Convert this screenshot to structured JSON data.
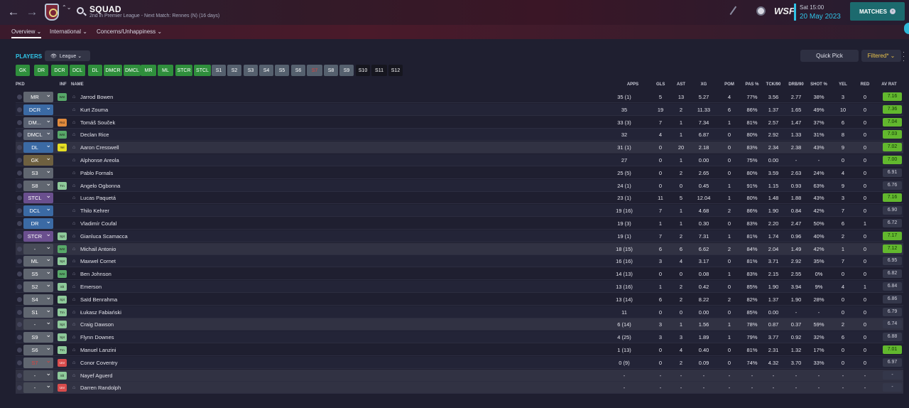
{
  "header": {
    "title": "SQUAD",
    "subtitle": "2nd in Premier League - Next Match: Rennes (N) (16 days)",
    "logo_text": "WSF",
    "date_line1": "Sat 15:00",
    "date_line2": "20 May 2023",
    "matches_label": "MATCHES",
    "back_icon": "←",
    "forward_icon": "→",
    "updown_icon": "⌃⌄"
  },
  "tabs": [
    {
      "label": "Overview ⌄"
    },
    {
      "label": "International ⌄"
    },
    {
      "label": "Concerns/Unhappiness ⌄"
    }
  ],
  "toolbar": {
    "players_label": "PLAYERS",
    "league_label": "League ⌄",
    "quick_pick_label": "Quick Pick",
    "filtered_label": "Filtered* ⌄"
  },
  "position_chips": [
    "GK",
    "DR",
    "DCR",
    "DCL",
    "DL",
    "DMCR",
    "DMCL",
    "MR",
    "ML",
    "STCR",
    "STCL",
    "S1",
    "S2",
    "S3",
    "S4",
    "S5",
    "S6",
    "S7",
    "S8",
    "S9",
    "S10",
    "S11",
    "S12"
  ],
  "columns": [
    "PKD",
    "INF",
    "NAME",
    "APPS",
    "GLS",
    "AST",
    "XG",
    "POM",
    "PAS %",
    "TCK/90",
    "DRB/90",
    "SHOT %",
    "YEL",
    "RED",
    "AV RAT"
  ],
  "players": [
    {
      "pos": "MR",
      "inf": "Wnt",
      "name": "Jarrod Bowen",
      "apps": "35 (1)",
      "gls": "5",
      "ast": "13",
      "xg": "5.27",
      "pom": "4",
      "pas": "77%",
      "tck": "3.56",
      "drb": "2.77",
      "shot": "38%",
      "yel": "3",
      "red": "0",
      "rat": "7.16"
    },
    {
      "pos": "DCR",
      "inf": "",
      "name": "Kurt Zouma",
      "apps": "35",
      "gls": "19",
      "ast": "2",
      "xg": "11.33",
      "pom": "6",
      "pas": "86%",
      "tck": "1.37",
      "drb": "1.65",
      "shot": "49%",
      "yel": "10",
      "red": "0",
      "rat": "7.36"
    },
    {
      "pos": "DM...",
      "inf": "Rst",
      "name": "Tomáš Souček",
      "apps": "33 (3)",
      "gls": "7",
      "ast": "1",
      "xg": "7.34",
      "pom": "1",
      "pas": "81%",
      "tck": "2.57",
      "drb": "1.47",
      "shot": "37%",
      "yel": "6",
      "red": "0",
      "rat": "7.04"
    },
    {
      "pos": "DMCL",
      "inf": "Wnt",
      "name": "Declan Rice",
      "apps": "32",
      "gls": "4",
      "ast": "1",
      "xg": "6.87",
      "pom": "0",
      "pas": "80%",
      "tck": "2.92",
      "drb": "1.33",
      "shot": "31%",
      "yel": "8",
      "red": "0",
      "rat": "7.03"
    },
    {
      "pos": "DL",
      "inf": "Yel",
      "name": "Aaron Cresswell",
      "apps": "31 (1)",
      "gls": "0",
      "ast": "20",
      "xg": "2.18",
      "pom": "0",
      "pas": "83%",
      "tck": "2.34",
      "drb": "2.38",
      "shot": "43%",
      "yel": "9",
      "red": "0",
      "rat": "7.02"
    },
    {
      "pos": "GK",
      "inf": "",
      "name": "Alphonse Areola",
      "apps": "27",
      "gls": "0",
      "ast": "1",
      "xg": "0.00",
      "pom": "0",
      "pas": "75%",
      "tck": "0.00",
      "drb": "-",
      "shot": "-",
      "yel": "0",
      "red": "0",
      "rat": "7.00"
    },
    {
      "pos": "S3",
      "inf": "",
      "name": "Pablo Fornals",
      "apps": "25 (5)",
      "gls": "0",
      "ast": "2",
      "xg": "2.65",
      "pom": "0",
      "pas": "80%",
      "tck": "3.59",
      "drb": "2.63",
      "shot": "24%",
      "yel": "4",
      "red": "0",
      "rat": "6.91"
    },
    {
      "pos": "S8",
      "inf": "Tm",
      "name": "Angelo Ogbonna",
      "apps": "24 (1)",
      "gls": "0",
      "ast": "0",
      "xg": "0.45",
      "pom": "1",
      "pas": "91%",
      "tck": "1.15",
      "drb": "0.93",
      "shot": "63%",
      "yel": "9",
      "red": "0",
      "rat": "6.76"
    },
    {
      "pos": "STCL",
      "inf": "",
      "name": "Lucas Paquetá",
      "apps": "23 (1)",
      "gls": "11",
      "ast": "5",
      "xg": "12.04",
      "pom": "1",
      "pas": "80%",
      "tck": "1.48",
      "drb": "1.88",
      "shot": "43%",
      "yel": "3",
      "red": "0",
      "rat": "7.16"
    },
    {
      "pos": "DCL",
      "inf": "",
      "name": "Thilo Kehrer",
      "apps": "19 (16)",
      "gls": "7",
      "ast": "1",
      "xg": "4.68",
      "pom": "2",
      "pas": "86%",
      "tck": "1.90",
      "drb": "0.84",
      "shot": "42%",
      "yel": "7",
      "red": "0",
      "rat": "6.90"
    },
    {
      "pos": "DR",
      "inf": "",
      "name": "Vladimír Coufal",
      "apps": "19 (3)",
      "gls": "1",
      "ast": "1",
      "xg": "0.30",
      "pom": "0",
      "pas": "83%",
      "tck": "2.20",
      "drb": "2.47",
      "shot": "50%",
      "yel": "6",
      "red": "1",
      "rat": "6.72"
    },
    {
      "pos": "STCR",
      "inf": "Spt",
      "name": "Gianluca Scamacca",
      "apps": "19 (1)",
      "gls": "7",
      "ast": "2",
      "xg": "7.31",
      "pom": "1",
      "pas": "81%",
      "tck": "1.74",
      "drb": "0.96",
      "shot": "40%",
      "yel": "2",
      "red": "0",
      "rat": "7.17"
    },
    {
      "pos": "-",
      "inf": "Wnt",
      "name": "Michail Antonio",
      "apps": "18 (15)",
      "gls": "6",
      "ast": "6",
      "xg": "6.62",
      "pom": "2",
      "pas": "84%",
      "tck": "2.04",
      "drb": "1.49",
      "shot": "42%",
      "yel": "1",
      "red": "0",
      "rat": "7.12"
    },
    {
      "pos": "ML",
      "inf": "Spt",
      "name": "Maxwel Cornet",
      "apps": "16 (16)",
      "gls": "3",
      "ast": "4",
      "xg": "3.17",
      "pom": "0",
      "pas": "81%",
      "tck": "3.71",
      "drb": "2.92",
      "shot": "35%",
      "yel": "7",
      "red": "0",
      "rat": "6.95"
    },
    {
      "pos": "S5",
      "inf": "Wnt",
      "name": "Ben Johnson",
      "apps": "14 (13)",
      "gls": "0",
      "ast": "0",
      "xg": "0.08",
      "pom": "1",
      "pas": "83%",
      "tck": "2.15",
      "drb": "2.55",
      "shot": "0%",
      "yel": "0",
      "red": "0",
      "rat": "6.82"
    },
    {
      "pos": "S2",
      "inf": "Slt",
      "name": "Emerson",
      "apps": "13 (16)",
      "gls": "1",
      "ast": "2",
      "xg": "0.42",
      "pom": "0",
      "pas": "85%",
      "tck": "1.90",
      "drb": "3.94",
      "shot": "9%",
      "yel": "4",
      "red": "1",
      "rat": "6.84"
    },
    {
      "pos": "S4",
      "inf": "Spt",
      "name": "Saïd Benrahma",
      "apps": "13 (14)",
      "gls": "6",
      "ast": "2",
      "xg": "8.22",
      "pom": "2",
      "pas": "82%",
      "tck": "1.37",
      "drb": "1.90",
      "shot": "28%",
      "yel": "0",
      "red": "0",
      "rat": "6.86"
    },
    {
      "pos": "S1",
      "inf": "Tm",
      "name": "Łukasz Fabiański",
      "apps": "11",
      "gls": "0",
      "ast": "0",
      "xg": "0.00",
      "pom": "0",
      "pas": "85%",
      "tck": "0.00",
      "drb": "-",
      "shot": "-",
      "yel": "0",
      "red": "0",
      "rat": "6.79"
    },
    {
      "pos": "-",
      "inf": "Spt",
      "name": "Craig Dawson",
      "apps": "6 (14)",
      "gls": "3",
      "ast": "1",
      "xg": "1.56",
      "pom": "1",
      "pas": "78%",
      "tck": "0.87",
      "drb": "0.37",
      "shot": "59%",
      "yel": "2",
      "red": "0",
      "rat": "6.74"
    },
    {
      "pos": "S9",
      "inf": "Spt",
      "name": "Flynn Downes",
      "apps": "4 (25)",
      "gls": "3",
      "ast": "3",
      "xg": "1.89",
      "pom": "1",
      "pas": "79%",
      "tck": "3.77",
      "drb": "0.92",
      "shot": "32%",
      "yel": "6",
      "red": "0",
      "rat": "6.88"
    },
    {
      "pos": "S6",
      "inf": "Tm",
      "name": "Manuel Lanzini",
      "apps": "1 (13)",
      "gls": "0",
      "ast": "4",
      "xg": "0.40",
      "pom": "0",
      "pas": "81%",
      "tck": "2.31",
      "drb": "1.32",
      "shot": "17%",
      "yel": "0",
      "red": "0",
      "rat": "7.01"
    },
    {
      "pos": "S7",
      "inf": "Unr",
      "name": "Conor Coventry",
      "apps": "0 (9)",
      "gls": "0",
      "ast": "2",
      "xg": "0.09",
      "pom": "0",
      "pas": "74%",
      "tck": "4.32",
      "drb": "3.70",
      "shot": "33%",
      "yel": "0",
      "red": "0",
      "rat": "6.97"
    },
    {
      "pos": "-",
      "inf": "Slt",
      "name": "Nayef Aguerd",
      "apps": "-",
      "gls": "-",
      "ast": "-",
      "xg": "-",
      "pom": "-",
      "pas": "-",
      "tck": "-",
      "drb": "-",
      "shot": "-",
      "yel": "-",
      "red": "-",
      "rat": "-"
    },
    {
      "pos": "-",
      "inf": "Unr",
      "name": "Darren Randolph",
      "apps": "-",
      "gls": "-",
      "ast": "-",
      "xg": "-",
      "pom": "-",
      "pas": "-",
      "tck": "-",
      "drb": "-",
      "shot": "-",
      "yel": "-",
      "red": "-",
      "rat": "-"
    }
  ]
}
